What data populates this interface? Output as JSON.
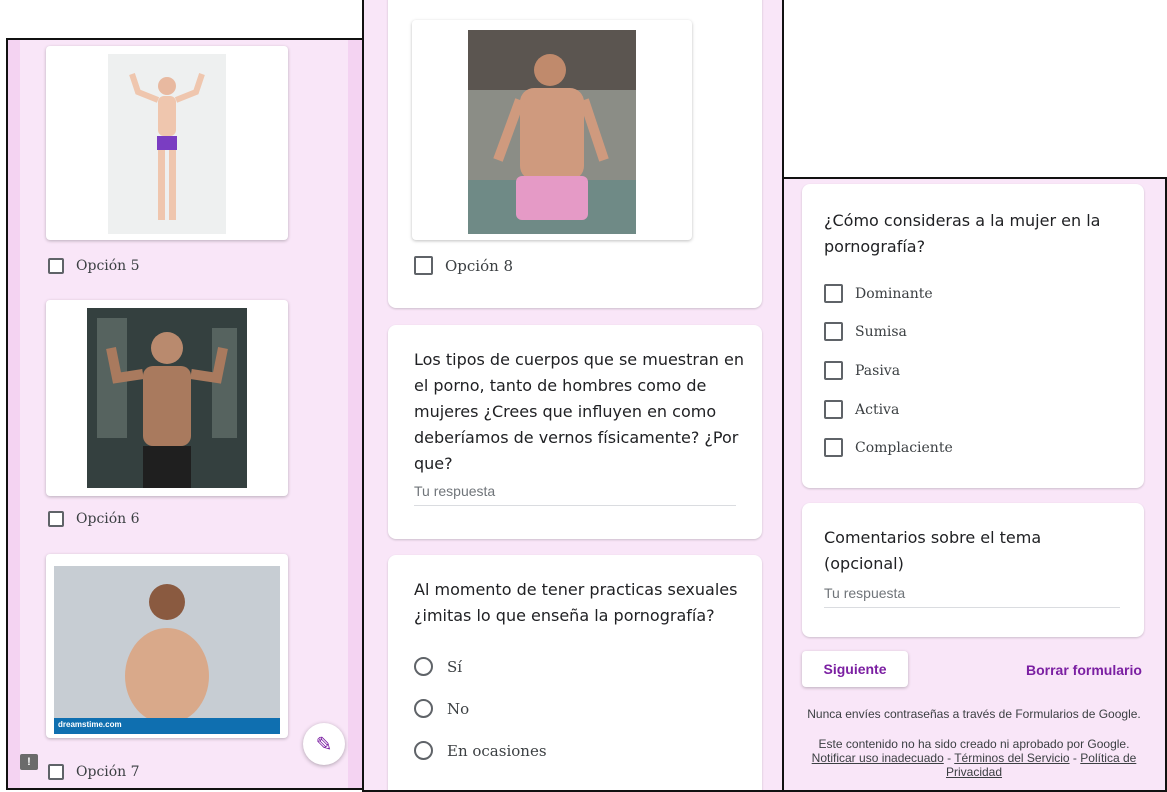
{
  "left": {
    "options": [
      {
        "label": "Opción 5"
      },
      {
        "label": "Opción 6"
      },
      {
        "label": "Opción 7"
      }
    ],
    "watermark": "dreamstime.com"
  },
  "middle": {
    "option8": "Opción 8",
    "q1": {
      "text": "Los tipos de cuerpos que se muestran en el porno, tanto de hombres como de mujeres ¿Crees que influyen en como deberíamos de vernos físicamente? ¿Por que?",
      "placeholder": "Tu respuesta"
    },
    "q2": {
      "text": "Al momento de tener practicas sexuales ¿imitas lo que enseña la pornografía?",
      "options": [
        "Sí",
        "No",
        "En ocasiones"
      ]
    }
  },
  "right": {
    "q3": {
      "text": "¿Cómo consideras a la mujer en la pornografía?",
      "options": [
        "Dominante",
        "Sumisa",
        "Pasiva",
        "Activa",
        "Complaciente"
      ]
    },
    "q4": {
      "text": "Comentarios sobre el tema (opcional)",
      "placeholder": "Tu respuesta"
    },
    "next_label": "Siguiente",
    "clear_label": "Borrar formulario",
    "footer_warning": "Nunca envíes contraseñas a través de Formularios de Google.",
    "footer_disclaimer": "Este contenido no ha sido creado ni aprobado por Google.",
    "footer_links": {
      "report": "Notificar uso inadecuado",
      "terms": "Términos del Servicio",
      "privacy": "Política de Privacidad"
    }
  },
  "colors": {
    "accent": "#7b1fa2",
    "background": "#f9e6f8"
  }
}
